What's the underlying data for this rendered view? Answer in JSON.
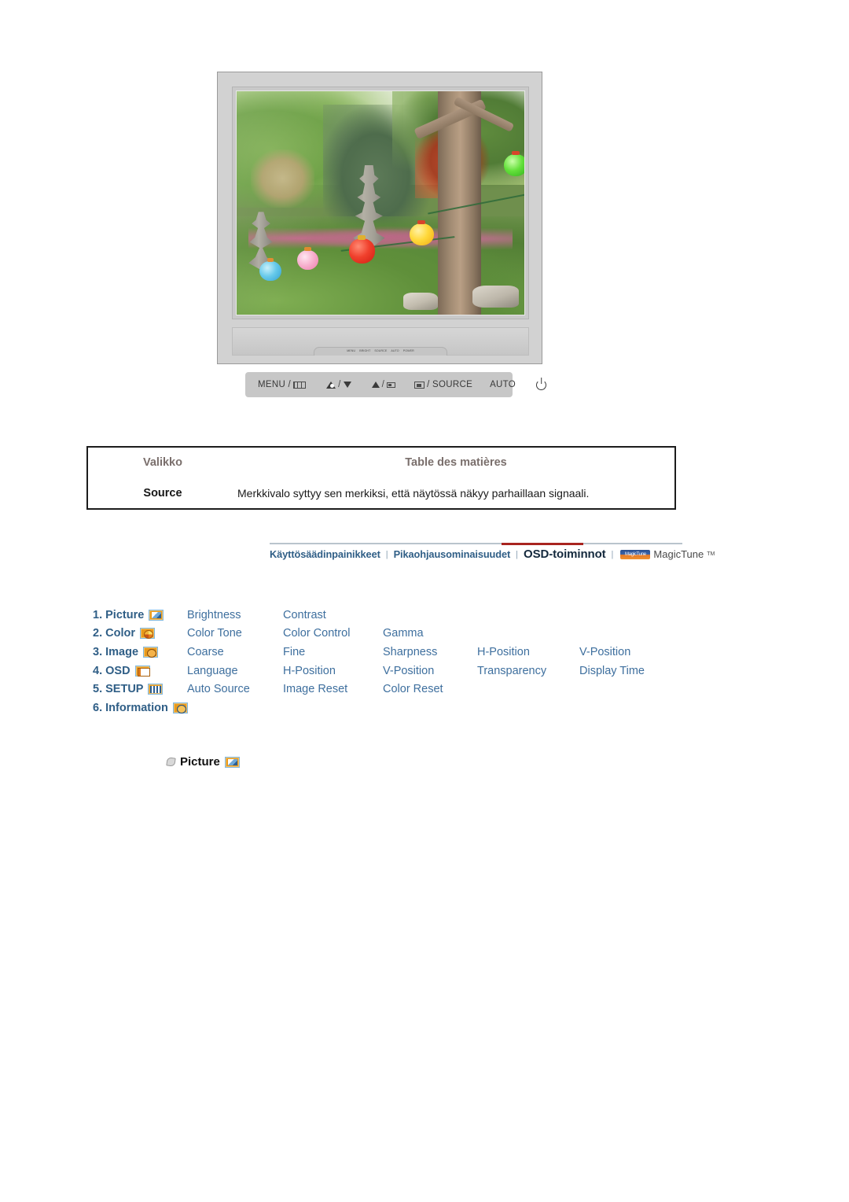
{
  "monitor": {
    "alt": "LCD monitor displaying a garden photo with a stone pagoda and paper lanterns",
    "oem_strip": [
      "MENU",
      "BRIGHT",
      "SOURCE",
      "AUTO",
      "POWER"
    ],
    "controls": [
      {
        "id": "menu",
        "label": "MENU /",
        "icon": "menu-bars-icon"
      },
      {
        "id": "bright",
        "label": "/",
        "icon": "brightness-down-icon"
      },
      {
        "id": "up",
        "label": "/",
        "icon": "up-arrow-icon"
      },
      {
        "id": "source",
        "label": "/ SOURCE",
        "icon": "enter-source-icon"
      },
      {
        "id": "auto",
        "label": "AUTO",
        "icon": ""
      },
      {
        "id": "power",
        "label": "",
        "icon": "power-icon"
      }
    ]
  },
  "table": {
    "headers": {
      "menu": "Valikko",
      "toc": "Table des matières"
    },
    "rows": [
      {
        "label": "Source",
        "description": "Merkkivalo syttyy sen merkiksi, että näytössä näkyy parhaillaan signaali."
      }
    ]
  },
  "nav": {
    "items": [
      {
        "label": "Käyttösäädinpainikkeet",
        "active": false
      },
      {
        "label": "Pikaohjausominaisuudet",
        "active": false
      },
      {
        "label": "OSD-toiminnot",
        "active": true
      }
    ],
    "separator": "|",
    "brand": {
      "mark_text": "MagicTune",
      "word": "MagicTune",
      "tm": "TM"
    },
    "active_underline_color": "#a8241f"
  },
  "osd_menu": {
    "rows": [
      {
        "num": "1. Picture",
        "icon": "picture-icon",
        "subs": [
          "Brightness",
          "Contrast"
        ]
      },
      {
        "num": "2. Color",
        "icon": "color-icon",
        "subs": [
          "Color Tone",
          "Color Control",
          "Gamma"
        ]
      },
      {
        "num": "3. Image",
        "icon": "image-icon",
        "subs": [
          "Coarse",
          "Fine",
          "Sharpness",
          "H-Position",
          "V-Position"
        ]
      },
      {
        "num": "4. OSD",
        "icon": "osd-icon",
        "subs": [
          "Language",
          "H-Position",
          "V-Position",
          "Transparency",
          "Display Time"
        ]
      },
      {
        "num": "5. SETUP",
        "icon": "setup-icon",
        "subs": [
          "Auto Source",
          "Image Reset",
          "Color Reset"
        ]
      },
      {
        "num": "6. Information",
        "icon": "information-icon",
        "subs": []
      }
    ]
  },
  "section": {
    "bullet": "diamond-bullet-icon",
    "title": "Picture",
    "icon": "picture-icon"
  },
  "colors": {
    "link_blue": "#2f5e86",
    "sub_blue": "#3e6f9e",
    "accent_red": "#a8241f",
    "icon_orange": "#e89a1c",
    "header_gray": "#7a6f6c"
  }
}
